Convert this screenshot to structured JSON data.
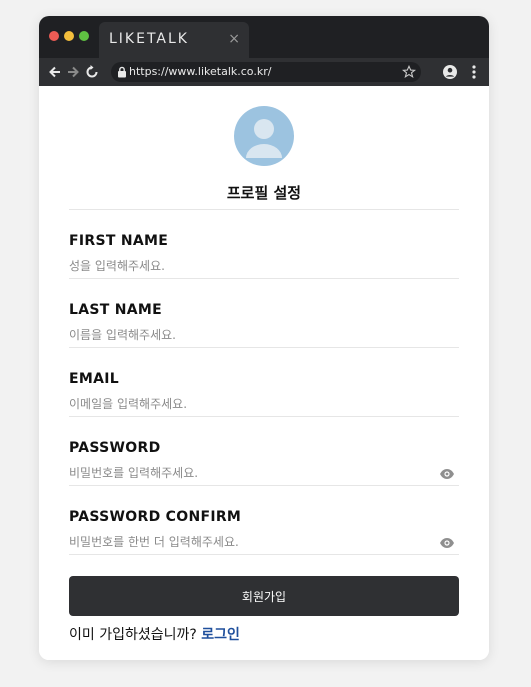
{
  "browser": {
    "tab_title": "LIKETALK",
    "tab_close": "×",
    "url": "https://www.liketalk.co.kr/"
  },
  "profile": {
    "title": "프로필 설정"
  },
  "form": {
    "fields": [
      {
        "label": "FIRST NAME",
        "placeholder": "성을 입력해주세요.",
        "value": ""
      },
      {
        "label": "LAST NAME",
        "placeholder": "이름을 입력해주세요.",
        "value": ""
      },
      {
        "label": "EMAIL",
        "placeholder": "이메일을 입력해주세요.",
        "value": ""
      },
      {
        "label": "PASSWORD",
        "placeholder": "비밀번호를 입력해주세요.",
        "value": ""
      },
      {
        "label": "PASSWORD CONFIRM",
        "placeholder": "비밀번호를 한번 더 입력해주세요.",
        "value": ""
      }
    ],
    "submit_label": "회원가입",
    "footer_text": "이미 가입하셨습니까? ",
    "login_label": "로그인"
  },
  "icons": {
    "window_controls": [
      "close-dot",
      "minimize-dot",
      "maximize-dot"
    ],
    "nav": [
      "arrow-left-icon",
      "arrow-right-icon",
      "reload-icon"
    ],
    "url_bar": [
      "lock-icon",
      "star-icon"
    ],
    "toolbar_right": [
      "account-icon",
      "menu-icon"
    ],
    "password_toggle": "eye-icon"
  },
  "colors": {
    "titlebar": "#1f2023",
    "toolbar": "#2f3033",
    "button": "#2f3033",
    "link": "#1f4f9c",
    "avatar": "#9cc3e0"
  }
}
